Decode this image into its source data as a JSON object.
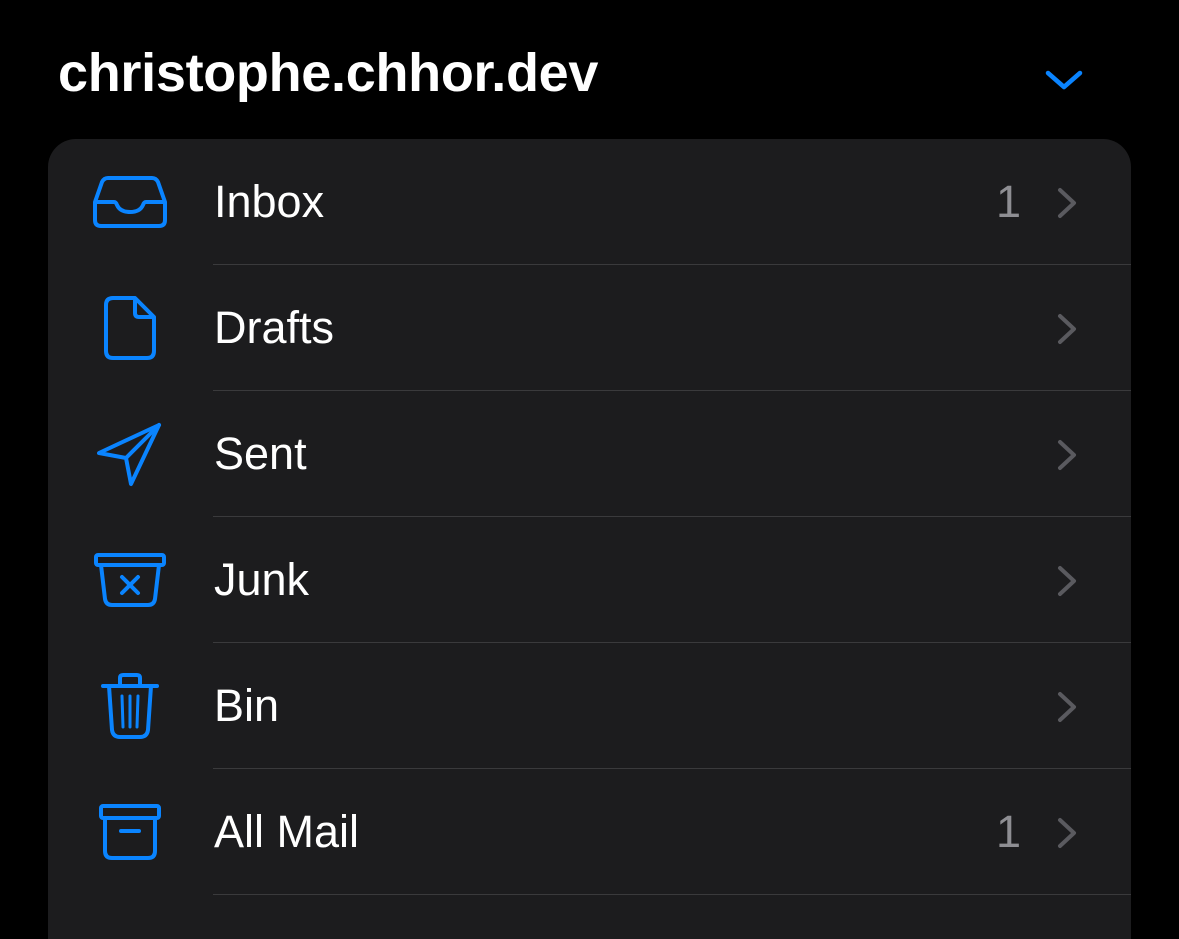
{
  "account": {
    "title": "christophe.chhor.dev",
    "expand_icon": "chevron-down-icon"
  },
  "colors": {
    "accent": "#0a84ff",
    "background": "#000000",
    "card": "#1c1c1e",
    "separator": "#3a3a3c",
    "secondary_text": "#8e8e93"
  },
  "mailboxes": [
    {
      "label": "Inbox",
      "count": "1",
      "icon": "inbox-tray-icon"
    },
    {
      "label": "Drafts",
      "count": "",
      "icon": "document-icon"
    },
    {
      "label": "Sent",
      "count": "",
      "icon": "paper-plane-icon"
    },
    {
      "label": "Junk",
      "count": "",
      "icon": "junk-bin-icon"
    },
    {
      "label": "Bin",
      "count": "",
      "icon": "trash-icon"
    },
    {
      "label": "All Mail",
      "count": "1",
      "icon": "archive-box-icon"
    }
  ]
}
